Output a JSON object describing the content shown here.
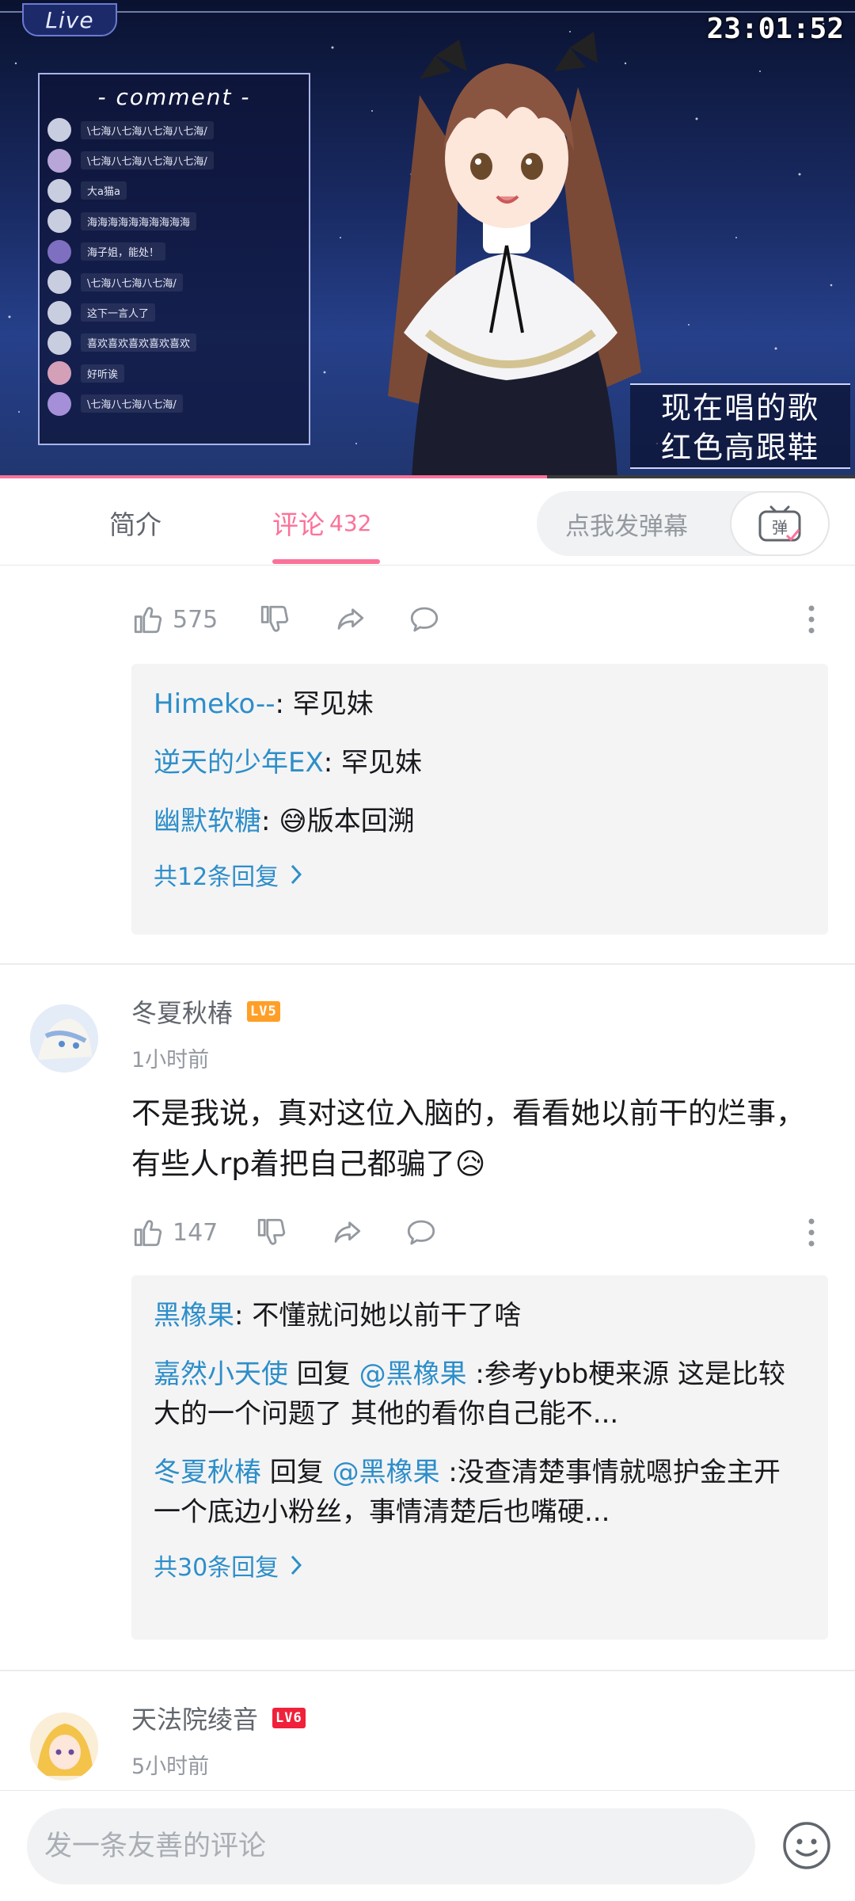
{
  "video": {
    "live_label": "Live",
    "clock": "23:01:52",
    "comment_title": "- comment -",
    "chat": [
      "\\七海八七海八七海八七海/",
      "\\七海八七海八七海八七海/",
      "大a猫a",
      "海海海海海海海海海海",
      "海子姐，能处！",
      "\\七海八七海八七海/",
      "这下一言人了",
      "喜欢喜欢喜欢喜欢喜欢",
      "好听诶",
      "\\七海八七海八七海/"
    ],
    "song_label": "现在唱的歌",
    "song_name": "红色高跟鞋",
    "progress_fraction": 0.64,
    "accent": "#fb7299"
  },
  "tabs": {
    "intro": "简介",
    "comments": "评论",
    "comments_count": "432",
    "danmaku_placeholder": "点我发弹幕",
    "danmaku_btn": "弹"
  },
  "comments": [
    {
      "likes": "575",
      "replies": [
        {
          "user": "Himeko--",
          "text": ": 罕见妹"
        },
        {
          "user": "逆天的少年EX",
          "text": ": 罕见妹"
        },
        {
          "user": "幽默软糖",
          "text": ": 😅版本回溯"
        }
      ],
      "replies_more": "共12条回复"
    },
    {
      "user": "冬夏秋椿",
      "level": "LV5",
      "time": "1小时前",
      "text": "不是我说，真对这位入脑的，看看她以前干的烂事，有些人rp着把自己都骗了😥",
      "likes": "147",
      "replies": [
        {
          "user": "黑橡果",
          "text": ": 不懂就问她以前干了啥"
        },
        {
          "user": "嘉然小天使",
          "mid": " 回复 ",
          "mention": "@黑橡果",
          "text": " :参考ybb梗来源 这是比较大的一个问题了 其他的看你自己能不..."
        },
        {
          "user": "冬夏秋椿",
          "mid": " 回复 ",
          "mention": "@黑橡果",
          "text": " :没查清楚事情就嗯护金主开一个底边小粉丝，事情清楚后也嘴硬..."
        }
      ],
      "replies_more": "共30条回复"
    },
    {
      "user": "天法院绫音",
      "level": "LV6",
      "time": "5小时前"
    }
  ],
  "bottom": {
    "input_placeholder": "发一条友善的评论"
  }
}
